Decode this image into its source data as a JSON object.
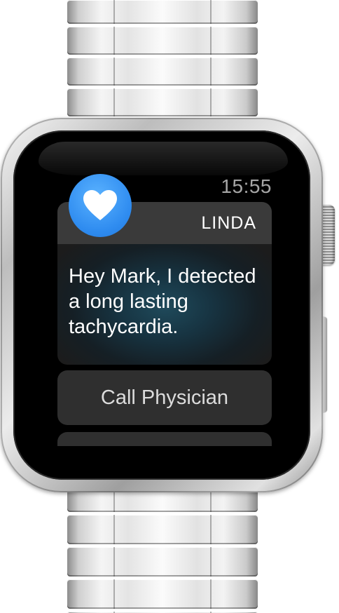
{
  "status_bar": {
    "time": "15:55"
  },
  "notification": {
    "app_name": "LINDA",
    "app_icon": "heart-icon",
    "message": "Hey Mark, I detected a long lasting tachycardia.",
    "icon_color": "#2f8cf0"
  },
  "actions": [
    {
      "label": "Call Physician"
    }
  ]
}
